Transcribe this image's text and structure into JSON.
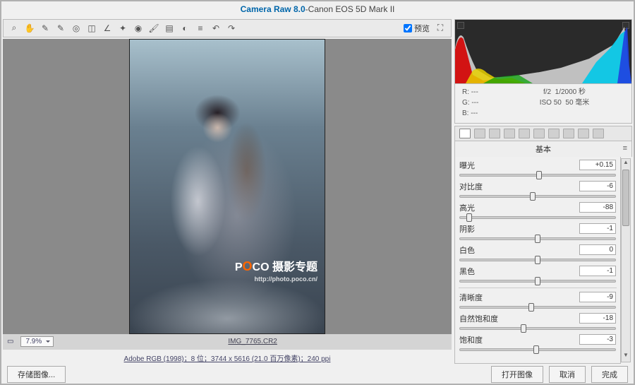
{
  "title": {
    "app": "Camera Raw 8.0",
    "sep": " -  ",
    "device": "Canon EOS 5D Mark II"
  },
  "preview_checkbox": "预览",
  "zoom": {
    "level": "7.9%"
  },
  "filename": "IMG_7765.CR2",
  "info_line": "Adobe RGB (1998)；8 位；3744 x 5616 (21.0 百万像素)；240 ppi",
  "watermark": {
    "brand_pre": "P",
    "brand_accent": "O",
    "brand_post": "CO",
    "text": "摄影专题",
    "url": "http://photo.poco.cn/"
  },
  "meta": {
    "channels": [
      "R:  ---",
      "G:  ---",
      "B:  ---"
    ],
    "fstop": "f/2",
    "shutter": "1/2000 秒",
    "iso": "ISO 50",
    "focal": "50 毫米"
  },
  "panel_name": "基本",
  "buttons": {
    "save": "存储图像...",
    "open": "打开图像",
    "cancel": "取消",
    "done": "完成"
  },
  "sliders": [
    {
      "id": "exposure",
      "label": "曝光",
      "value": "+0.15",
      "pos": 51,
      "group": 0
    },
    {
      "id": "contrast",
      "label": "对比度",
      "value": "-6",
      "pos": 47,
      "group": 0
    },
    {
      "id": "highlights",
      "label": "高光",
      "value": "-88",
      "pos": 6,
      "group": 0
    },
    {
      "id": "shadows",
      "label": "阴影",
      "value": "-1",
      "pos": 50,
      "group": 0
    },
    {
      "id": "whites",
      "label": "白色",
      "value": "0",
      "pos": 50,
      "group": 0
    },
    {
      "id": "blacks",
      "label": "黑色",
      "value": "-1",
      "pos": 50,
      "group": 0
    },
    {
      "id": "clarity",
      "label": "清晰度",
      "value": "-9",
      "pos": 46,
      "group": 1
    },
    {
      "id": "vibrance",
      "label": "自然饱和度",
      "value": "-18",
      "pos": 41,
      "group": 1
    },
    {
      "id": "saturation",
      "label": "饱和度",
      "value": "-3",
      "pos": 49,
      "group": 1
    }
  ],
  "tools": [
    "zoom",
    "hand",
    "eyedropper",
    "sampler",
    "target",
    "crop",
    "straighten",
    "spot",
    "redeye",
    "brush",
    "grad",
    "radial",
    "prefs",
    "rotate-l",
    "rotate-r"
  ]
}
